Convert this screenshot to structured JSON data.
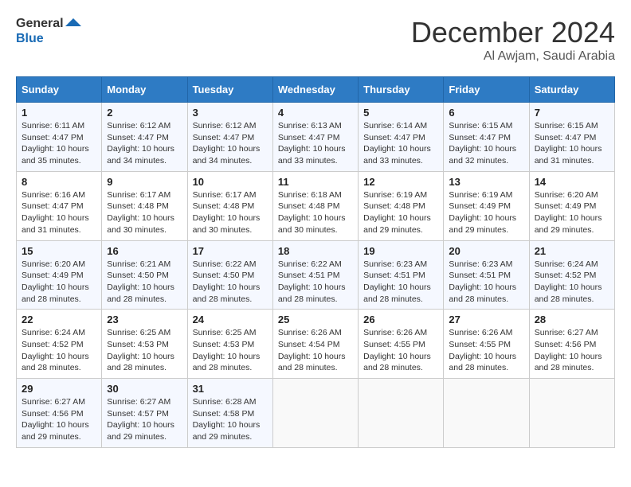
{
  "logo": {
    "line1": "General",
    "line2": "Blue"
  },
  "header": {
    "month": "December 2024",
    "location": "Al Awjam, Saudi Arabia"
  },
  "weekdays": [
    "Sunday",
    "Monday",
    "Tuesday",
    "Wednesday",
    "Thursday",
    "Friday",
    "Saturday"
  ],
  "weeks": [
    [
      {
        "day": 1,
        "sunrise": "6:11 AM",
        "sunset": "4:47 PM",
        "daylight": "10 hours and 35 minutes."
      },
      {
        "day": 2,
        "sunrise": "6:12 AM",
        "sunset": "4:47 PM",
        "daylight": "10 hours and 34 minutes."
      },
      {
        "day": 3,
        "sunrise": "6:12 AM",
        "sunset": "4:47 PM",
        "daylight": "10 hours and 34 minutes."
      },
      {
        "day": 4,
        "sunrise": "6:13 AM",
        "sunset": "4:47 PM",
        "daylight": "10 hours and 33 minutes."
      },
      {
        "day": 5,
        "sunrise": "6:14 AM",
        "sunset": "4:47 PM",
        "daylight": "10 hours and 33 minutes."
      },
      {
        "day": 6,
        "sunrise": "6:15 AM",
        "sunset": "4:47 PM",
        "daylight": "10 hours and 32 minutes."
      },
      {
        "day": 7,
        "sunrise": "6:15 AM",
        "sunset": "4:47 PM",
        "daylight": "10 hours and 31 minutes."
      }
    ],
    [
      {
        "day": 8,
        "sunrise": "6:16 AM",
        "sunset": "4:47 PM",
        "daylight": "10 hours and 31 minutes."
      },
      {
        "day": 9,
        "sunrise": "6:17 AM",
        "sunset": "4:48 PM",
        "daylight": "10 hours and 30 minutes."
      },
      {
        "day": 10,
        "sunrise": "6:17 AM",
        "sunset": "4:48 PM",
        "daylight": "10 hours and 30 minutes."
      },
      {
        "day": 11,
        "sunrise": "6:18 AM",
        "sunset": "4:48 PM",
        "daylight": "10 hours and 30 minutes."
      },
      {
        "day": 12,
        "sunrise": "6:19 AM",
        "sunset": "4:48 PM",
        "daylight": "10 hours and 29 minutes."
      },
      {
        "day": 13,
        "sunrise": "6:19 AM",
        "sunset": "4:49 PM",
        "daylight": "10 hours and 29 minutes."
      },
      {
        "day": 14,
        "sunrise": "6:20 AM",
        "sunset": "4:49 PM",
        "daylight": "10 hours and 29 minutes."
      }
    ],
    [
      {
        "day": 15,
        "sunrise": "6:20 AM",
        "sunset": "4:49 PM",
        "daylight": "10 hours and 28 minutes."
      },
      {
        "day": 16,
        "sunrise": "6:21 AM",
        "sunset": "4:50 PM",
        "daylight": "10 hours and 28 minutes."
      },
      {
        "day": 17,
        "sunrise": "6:22 AM",
        "sunset": "4:50 PM",
        "daylight": "10 hours and 28 minutes."
      },
      {
        "day": 18,
        "sunrise": "6:22 AM",
        "sunset": "4:51 PM",
        "daylight": "10 hours and 28 minutes."
      },
      {
        "day": 19,
        "sunrise": "6:23 AM",
        "sunset": "4:51 PM",
        "daylight": "10 hours and 28 minutes."
      },
      {
        "day": 20,
        "sunrise": "6:23 AM",
        "sunset": "4:51 PM",
        "daylight": "10 hours and 28 minutes."
      },
      {
        "day": 21,
        "sunrise": "6:24 AM",
        "sunset": "4:52 PM",
        "daylight": "10 hours and 28 minutes."
      }
    ],
    [
      {
        "day": 22,
        "sunrise": "6:24 AM",
        "sunset": "4:52 PM",
        "daylight": "10 hours and 28 minutes."
      },
      {
        "day": 23,
        "sunrise": "6:25 AM",
        "sunset": "4:53 PM",
        "daylight": "10 hours and 28 minutes."
      },
      {
        "day": 24,
        "sunrise": "6:25 AM",
        "sunset": "4:53 PM",
        "daylight": "10 hours and 28 minutes."
      },
      {
        "day": 25,
        "sunrise": "6:26 AM",
        "sunset": "4:54 PM",
        "daylight": "10 hours and 28 minutes."
      },
      {
        "day": 26,
        "sunrise": "6:26 AM",
        "sunset": "4:55 PM",
        "daylight": "10 hours and 28 minutes."
      },
      {
        "day": 27,
        "sunrise": "6:26 AM",
        "sunset": "4:55 PM",
        "daylight": "10 hours and 28 minutes."
      },
      {
        "day": 28,
        "sunrise": "6:27 AM",
        "sunset": "4:56 PM",
        "daylight": "10 hours and 28 minutes."
      }
    ],
    [
      {
        "day": 29,
        "sunrise": "6:27 AM",
        "sunset": "4:56 PM",
        "daylight": "10 hours and 29 minutes."
      },
      {
        "day": 30,
        "sunrise": "6:27 AM",
        "sunset": "4:57 PM",
        "daylight": "10 hours and 29 minutes."
      },
      {
        "day": 31,
        "sunrise": "6:28 AM",
        "sunset": "4:58 PM",
        "daylight": "10 hours and 29 minutes."
      },
      null,
      null,
      null,
      null
    ]
  ],
  "labels": {
    "sunrise": "Sunrise:",
    "sunset": "Sunset:",
    "daylight": "Daylight:"
  }
}
